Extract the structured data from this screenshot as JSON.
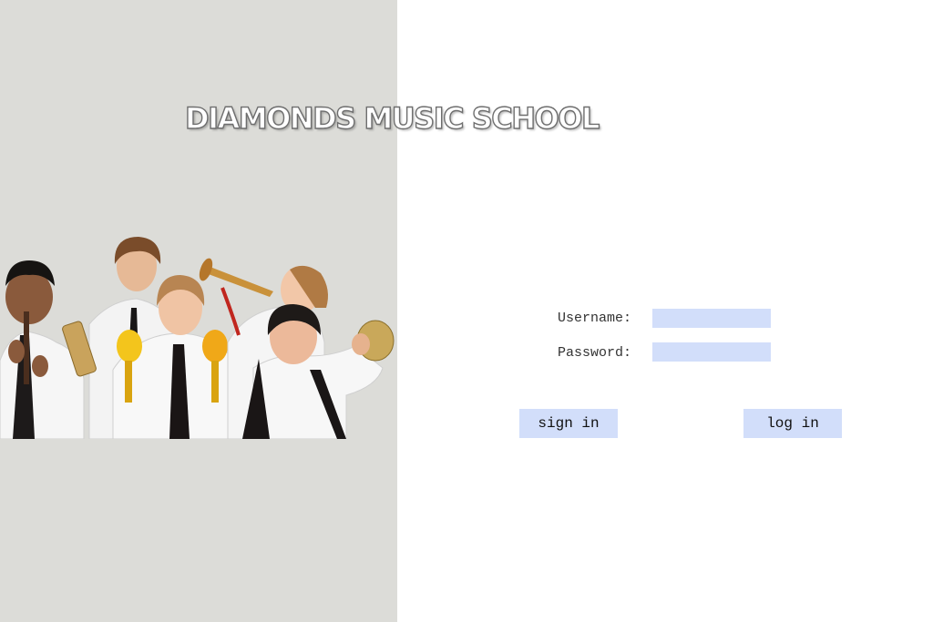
{
  "app": {
    "title": "DIAMONDS MUSIC SCHOOL"
  },
  "hero": {
    "image": "kids-with-instruments-photo"
  },
  "login_form": {
    "username_label": "Username:",
    "username_value": "",
    "password_label": "Password:",
    "password_value": "",
    "sign_in_label": "sign in",
    "log_in_label": "log in"
  },
  "colors": {
    "left_panel_bg": "#dcdcd8",
    "input_bg": "#d2defa",
    "button_bg": "#d2defa",
    "page_bg": "#ffffff"
  }
}
